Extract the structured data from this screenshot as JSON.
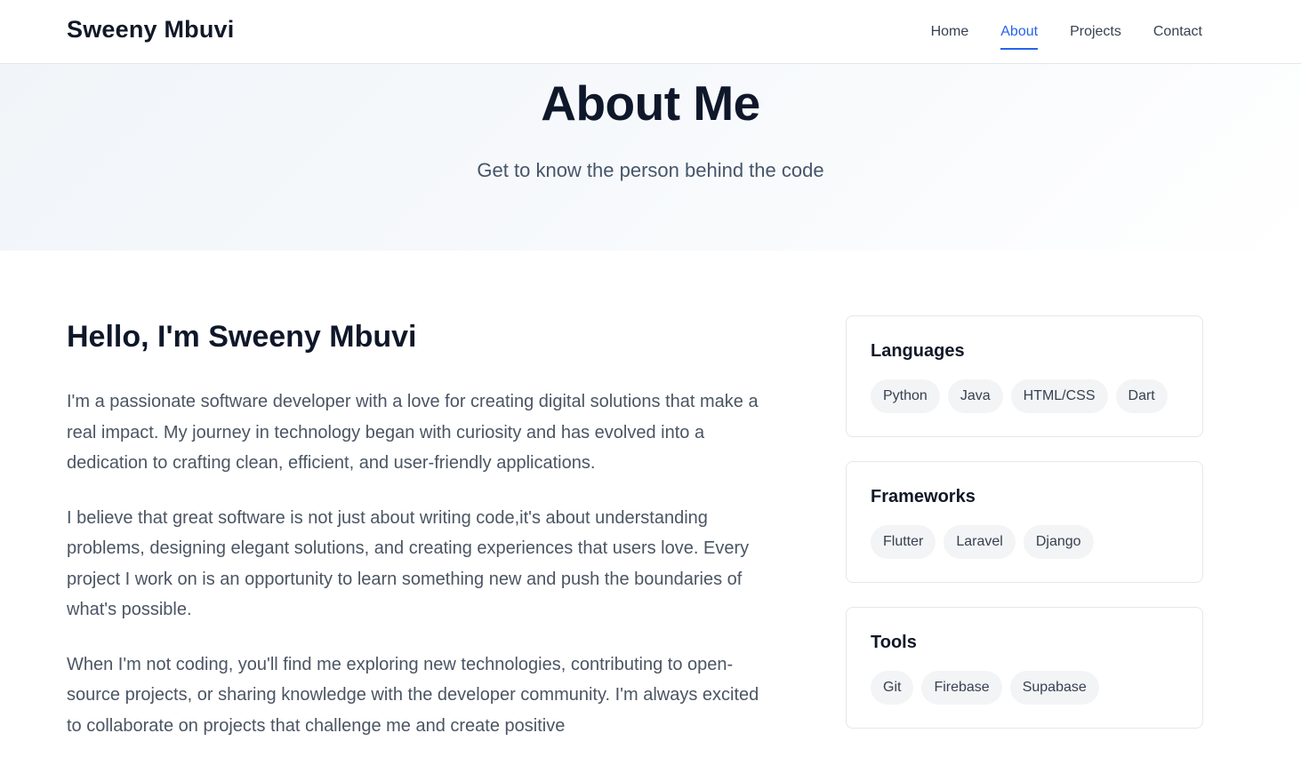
{
  "brand": "Sweeny Mbuvi",
  "nav": [
    {
      "label": "Home",
      "active": false
    },
    {
      "label": "About",
      "active": true
    },
    {
      "label": "Projects",
      "active": false
    },
    {
      "label": "Contact",
      "active": false
    }
  ],
  "hero": {
    "title": "About Me",
    "subtitle": "Get to know the person behind the code"
  },
  "main": {
    "greeting": "Hello, I'm Sweeny Mbuvi",
    "paragraphs": [
      "I'm a passionate software developer with a love for creating digital solutions that make a real impact. My journey in technology began with curiosity and has evolved into a dedication to crafting clean, efficient, and user-friendly applications.",
      "I believe that great software is not just about writing code,it's about understanding problems, designing elegant solutions, and creating experiences that users love. Every project I work on is an opportunity to learn something new and push the boundaries of what's possible.",
      "When I'm not coding, you'll find me exploring new technologies, contributing to open-source projects, or sharing knowledge with the developer community. I'm always excited to collaborate on projects that challenge me and create positive"
    ]
  },
  "skills": [
    {
      "title": "Languages",
      "items": [
        "Python",
        "Java",
        "HTML/CSS",
        "Dart"
      ]
    },
    {
      "title": "Frameworks",
      "items": [
        "Flutter",
        "Laravel",
        "Django"
      ]
    },
    {
      "title": "Tools",
      "items": [
        "Git",
        "Firebase",
        "Supabase"
      ]
    }
  ],
  "colors": {
    "accent": "#2563eb",
    "text": "#0f172a",
    "muted": "#4b5563",
    "tag_bg": "#f3f4f6"
  }
}
